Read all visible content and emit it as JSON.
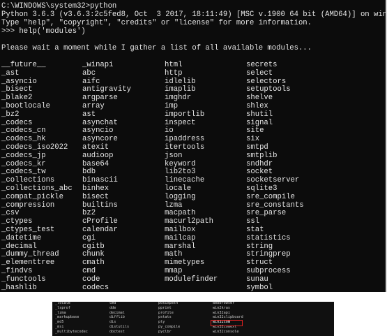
{
  "terminal": {
    "prompt": "C:\\WINDOWS\\system32>python",
    "banner1": "Python 3.6.3 (v3.6.3:2c5fed8, Oct  3 2017, 18:11:49) [MSC v.1900 64 bit (AMD64)] on win32",
    "banner2": "Type \"help\", \"copyright\", \"credits\" or \"license\" for more information.",
    "command": ">>> help('modules')",
    "wait_message": "Please wait a moment while I gather a list of all available modules..."
  },
  "modules": {
    "col1": [
      "__future__",
      "_ast",
      "_asyncio",
      "_bisect",
      "_blake2",
      "_bootlocale",
      "_bz2",
      "_codecs",
      "_codecs_cn",
      "_codecs_hk",
      "_codecs_iso2022",
      "_codecs_jp",
      "_codecs_kr",
      "_codecs_tw",
      "_collections",
      "_collections_abc",
      "_compat_pickle",
      "_compression",
      "_csv",
      "_ctypes",
      "_ctypes_test",
      "_datetime",
      "_decimal",
      "_dummy_thread",
      "_elementtree",
      "_findvs",
      "_functools",
      "_hashlib"
    ],
    "col2": [
      "_winapi",
      "abc",
      "aifc",
      "antigravity",
      "argparse",
      "array",
      "ast",
      "asynchat",
      "asyncio",
      "asyncore",
      "atexit",
      "audioop",
      "base64",
      "bdb",
      "binascii",
      "binhex",
      "bisect",
      "builtins",
      "bz2",
      "cProfile",
      "calendar",
      "cgi",
      "cgitb",
      "chunk",
      "cmath",
      "cmd",
      "code",
      "codecs"
    ],
    "col3": [
      "html",
      "http",
      "idlelib",
      "imaplib",
      "imghdr",
      "imp",
      "importlib",
      "inspect",
      "io",
      "ipaddress",
      "itertools",
      "json",
      "keyword",
      "lib2to3",
      "linecache",
      "locale",
      "logging",
      "lzma",
      "macpath",
      "macurl2path",
      "mailbox",
      "mailcap",
      "marshal",
      "math",
      "mimetypes",
      "mmap",
      "modulefinder",
      ""
    ],
    "col4": [
      "secrets",
      "select",
      "selectors",
      "setuptools",
      "shelve",
      "shlex",
      "shutil",
      "signal",
      "site",
      "six",
      "smtpd",
      "smtplib",
      "sndhdr",
      "socket",
      "socketserver",
      "sqlite3",
      "sre_compile",
      "sre_constants",
      "sre_parse",
      "ssl",
      "stat",
      "statistics",
      "string",
      "stringprep",
      "struct",
      "subprocess",
      "sunau",
      "symbol"
    ]
  },
  "thumbnail": {
    "col1": [
      "_locale",
      "_lsprof",
      "_lzma",
      "_markupbase",
      "_md5",
      "_msi",
      "_multibytecodec"
    ],
    "col2": [
      "cmd",
      "dde",
      "decimal",
      "difflib",
      "dis",
      "distutils",
      "doctest"
    ],
    "col3": [
      "posixpath",
      "pprint",
      "profile",
      "pstats",
      "pty",
      "py_compile",
      "pyclbr"
    ],
    "col4": [
      "webbrowser",
      "win2kras",
      "win32api",
      "win32clipboard",
      "win32com",
      "win32comext",
      "win32console"
    ],
    "highlighted": "win32com",
    "highlight_color": "#e02020"
  },
  "colors": {
    "console_bg": "#0c0c0c",
    "console_text": "#e6e6e6",
    "page_bg": "#ffffff"
  }
}
